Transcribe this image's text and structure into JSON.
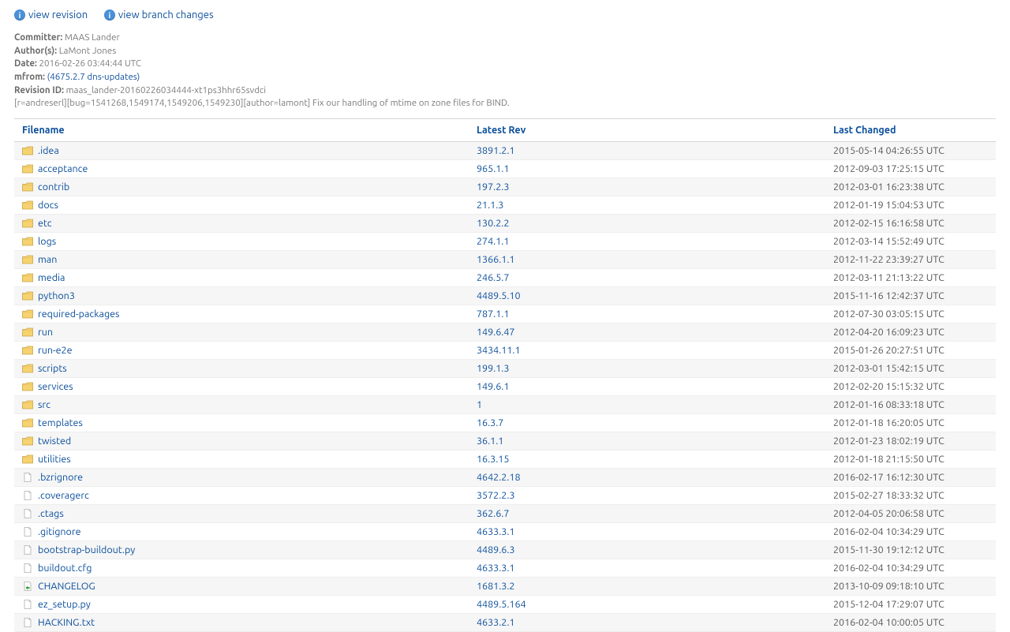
{
  "actions": {
    "view_revision": "view revision",
    "view_branch_changes": "view branch changes"
  },
  "meta": {
    "committer_label": "Committer:",
    "committer": "MAAS Lander",
    "authors_label": "Author(s):",
    "authors": "LaMont Jones",
    "date_label": "Date:",
    "date": "2016-02-26 03:44:44 UTC",
    "mfrom_label": "mfrom:",
    "mfrom": "(4675.2.7 dns-updates)",
    "revid_label": "Revision ID:",
    "revid": "maas_lander-20160226034444-xt1ps3hhr65svdci",
    "message": "[r=andreserl][bug=1541268,1549174,1549206,1549230][author=lamont] Fix our handling of mtime on zone files for BIND."
  },
  "columns": {
    "filename": "Filename",
    "latest_rev": "Latest Rev",
    "last_changed": "Last Changed"
  },
  "rows": [
    {
      "type": "folder",
      "name": ".idea",
      "rev": "3891.2.1",
      "date": "2015-05-14 04:26:55 UTC"
    },
    {
      "type": "folder",
      "name": "acceptance",
      "rev": "965.1.1",
      "date": "2012-09-03 17:25:15 UTC"
    },
    {
      "type": "folder",
      "name": "contrib",
      "rev": "197.2.3",
      "date": "2012-03-01 16:23:38 UTC"
    },
    {
      "type": "folder",
      "name": "docs",
      "rev": "21.1.3",
      "date": "2012-01-19 15:04:53 UTC"
    },
    {
      "type": "folder",
      "name": "etc",
      "rev": "130.2.2",
      "date": "2012-02-15 16:16:58 UTC"
    },
    {
      "type": "folder",
      "name": "logs",
      "rev": "274.1.1",
      "date": "2012-03-14 15:52:49 UTC"
    },
    {
      "type": "folder",
      "name": "man",
      "rev": "1366.1.1",
      "date": "2012-11-22 23:39:27 UTC"
    },
    {
      "type": "folder",
      "name": "media",
      "rev": "246.5.7",
      "date": "2012-03-11 21:13:22 UTC"
    },
    {
      "type": "folder",
      "name": "python3",
      "rev": "4489.5.10",
      "date": "2015-11-16 12:42:37 UTC"
    },
    {
      "type": "folder",
      "name": "required-packages",
      "rev": "787.1.1",
      "date": "2012-07-30 03:05:15 UTC"
    },
    {
      "type": "folder",
      "name": "run",
      "rev": "149.6.47",
      "date": "2012-04-20 16:09:23 UTC"
    },
    {
      "type": "folder",
      "name": "run-e2e",
      "rev": "3434.11.1",
      "date": "2015-01-26 20:27:51 UTC"
    },
    {
      "type": "folder",
      "name": "scripts",
      "rev": "199.1.3",
      "date": "2012-03-01 15:42:15 UTC"
    },
    {
      "type": "folder",
      "name": "services",
      "rev": "149.6.1",
      "date": "2012-02-20 15:15:32 UTC"
    },
    {
      "type": "folder",
      "name": "src",
      "rev": "1",
      "date": "2012-01-16 08:33:18 UTC"
    },
    {
      "type": "folder",
      "name": "templates",
      "rev": "16.3.7",
      "date": "2012-01-18 16:20:05 UTC"
    },
    {
      "type": "folder",
      "name": "twisted",
      "rev": "36.1.1",
      "date": "2012-01-23 18:02:19 UTC"
    },
    {
      "type": "folder",
      "name": "utilities",
      "rev": "16.3.15",
      "date": "2012-01-18 21:15:50 UTC"
    },
    {
      "type": "file",
      "name": ".bzrignore",
      "rev": "4642.2.18",
      "date": "2016-02-17 16:12:30 UTC"
    },
    {
      "type": "file",
      "name": ".coveragerc",
      "rev": "3572.2.3",
      "date": "2015-02-27 18:33:32 UTC"
    },
    {
      "type": "file",
      "name": ".ctags",
      "rev": "362.6.7",
      "date": "2012-04-05 20:06:58 UTC"
    },
    {
      "type": "file",
      "name": ".gitignore",
      "rev": "4633.3.1",
      "date": "2016-02-04 10:34:29 UTC"
    },
    {
      "type": "file",
      "name": "bootstrap-buildout.py",
      "rev": "4489.6.3",
      "date": "2015-11-30 19:12:12 UTC"
    },
    {
      "type": "file",
      "name": "buildout.cfg",
      "rev": "4633.3.1",
      "date": "2016-02-04 10:34:29 UTC"
    },
    {
      "type": "symlink",
      "name": "CHANGELOG",
      "rev": "1681.3.2",
      "date": "2013-10-09 09:18:10 UTC"
    },
    {
      "type": "file",
      "name": "ez_setup.py",
      "rev": "4489.5.164",
      "date": "2015-12-04 17:29:07 UTC"
    },
    {
      "type": "file",
      "name": "HACKING.txt",
      "rev": "4633.2.1",
      "date": "2016-02-04 10:00:05 UTC"
    }
  ]
}
